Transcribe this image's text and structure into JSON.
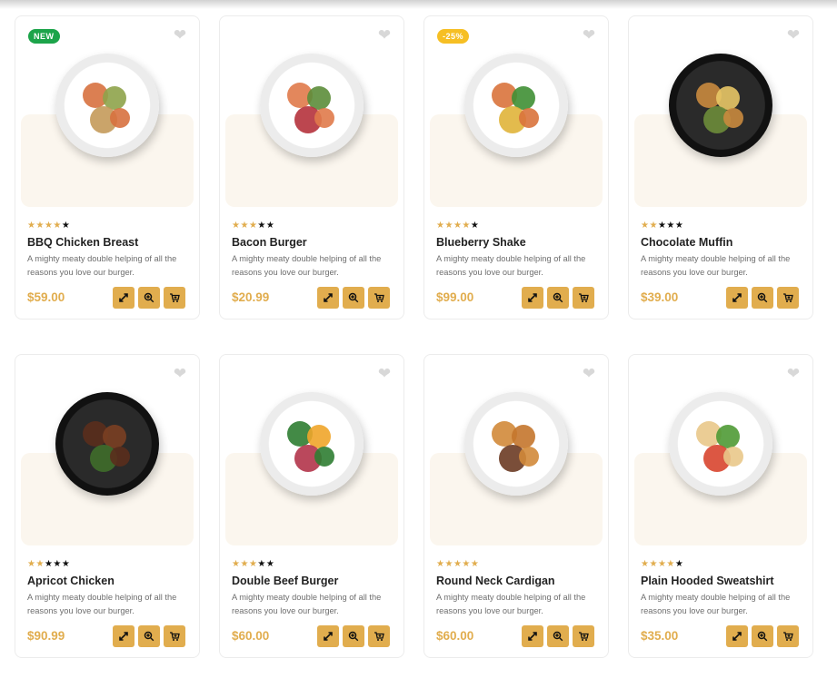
{
  "colors": {
    "accent": "#e1ad4e",
    "new_badge": "#1ca44a",
    "discount_badge": "#f6bf24",
    "image_bg": "#fbf6ee"
  },
  "icons": {
    "wishlist": "heart-icon",
    "compare": "compare-arrows-icon",
    "quick_view": "zoom-in-icon",
    "cart": "add-to-cart-icon"
  },
  "products": [
    {
      "badge": "NEW",
      "badge_type": "new",
      "rating": 4,
      "name": "BBQ Chicken Breast",
      "description": "A mighty meaty double helping of all the reasons you love our burger.",
      "price": "$59.00",
      "plate": "light"
    },
    {
      "badge": "",
      "badge_type": "",
      "rating": 3,
      "name": "Bacon Burger",
      "description": "A mighty meaty double helping of all the reasons you love our burger.",
      "price": "$20.99",
      "plate": "light"
    },
    {
      "badge": "-25%",
      "badge_type": "discount",
      "rating": 4,
      "name": "Blueberry Shake",
      "description": "A mighty meaty double helping of all the reasons you love our burger.",
      "price": "$99.00",
      "plate": "light"
    },
    {
      "badge": "",
      "badge_type": "",
      "rating": 2,
      "name": "Chocolate Muffin",
      "description": "A mighty meaty double helping of all the reasons you love our burger.",
      "price": "$39.00",
      "plate": "dark"
    },
    {
      "badge": "",
      "badge_type": "",
      "rating": 2,
      "name": "Apricot Chicken",
      "description": "A mighty meaty double helping of all the reasons you love our burger.",
      "price": "$90.99",
      "plate": "dark"
    },
    {
      "badge": "",
      "badge_type": "",
      "rating": 3,
      "name": "Double Beef Burger",
      "description": "A mighty meaty double helping of all the reasons you love our burger.",
      "price": "$60.00",
      "plate": "light"
    },
    {
      "badge": "",
      "badge_type": "",
      "rating": 5,
      "name": "Round Neck Cardigan",
      "description": "A mighty meaty double helping of all the reasons you love our burger.",
      "price": "$60.00",
      "plate": "light"
    },
    {
      "badge": "",
      "badge_type": "",
      "rating": 4,
      "name": "Plain Hooded Sweatshirt",
      "description": "A mighty meaty double helping of all the reasons you love our burger.",
      "price": "$35.00",
      "plate": "light"
    }
  ]
}
